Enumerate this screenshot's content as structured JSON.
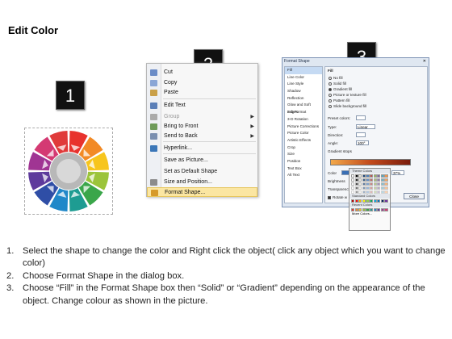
{
  "title": "Edit Color",
  "badges": [
    "1",
    "2",
    "3"
  ],
  "wheel": {
    "segment_colors": [
      "#e8322d",
      "#f28a25",
      "#f7c51d",
      "#9bc43a",
      "#3aa64a",
      "#1e9c92",
      "#1f88c9",
      "#2f4ea6",
      "#5e3a9c",
      "#a03593",
      "#d43a73",
      "#e03a3a"
    ],
    "center_color": "#b8b8b8"
  },
  "context_menu": {
    "items": [
      {
        "label": "Cut",
        "icon": "cut-icon",
        "enabled": true,
        "submenu": false
      },
      {
        "label": "Copy",
        "icon": "copy-icon",
        "enabled": true,
        "submenu": false
      },
      {
        "label": "Paste",
        "icon": "paste-icon",
        "enabled": true,
        "submenu": false
      },
      {
        "label": "Edit Text",
        "icon": "edit-text-icon",
        "enabled": true,
        "submenu": false
      },
      {
        "label": "Group",
        "icon": "group-icon",
        "enabled": false,
        "submenu": true
      },
      {
        "label": "Bring to Front",
        "icon": "bring-to-front-icon",
        "enabled": true,
        "submenu": true
      },
      {
        "label": "Send to Back",
        "icon": "send-to-back-icon",
        "enabled": true,
        "submenu": true
      },
      {
        "label": "Hyperlink...",
        "icon": "hyperlink-icon",
        "enabled": true,
        "submenu": false
      },
      {
        "label": "Save as Picture...",
        "icon": "",
        "enabled": true,
        "submenu": false
      },
      {
        "label": "Set as Default Shape",
        "icon": "",
        "enabled": true,
        "submenu": false
      },
      {
        "label": "Size and Position...",
        "icon": "size-position-icon",
        "enabled": true,
        "submenu": false
      },
      {
        "label": "Format Shape...",
        "icon": "format-shape-icon",
        "enabled": true,
        "submenu": false,
        "highlighted": true
      }
    ]
  },
  "format_dialog": {
    "title": "Format Shape",
    "categories": [
      "Fill",
      "Line Color",
      "Line Style",
      "Shadow",
      "Reflection",
      "Glow and Soft Edges",
      "3-D Format",
      "3-D Rotation",
      "Picture Corrections",
      "Picture Color",
      "Artistic Effects",
      "Crop",
      "Size",
      "Position",
      "Text Box",
      "Alt Text"
    ],
    "section_title": "Fill",
    "fill_options": [
      {
        "label": "No fill",
        "checked": false
      },
      {
        "label": "Solid fill",
        "checked": false
      },
      {
        "label": "Gradient fill",
        "checked": true
      },
      {
        "label": "Picture or texture fill",
        "checked": false
      },
      {
        "label": "Pattern fill",
        "checked": false
      },
      {
        "label": "Slide background fill",
        "checked": false
      }
    ],
    "preset_colors_label": "Preset colors:",
    "type_label": "Type:",
    "type_value": "Linear",
    "direction_label": "Direction:",
    "angle_label": "Angle:",
    "angle_value": "100°",
    "gradient_stops_label": "Gradient stops",
    "color_label": "Color",
    "position_label": "Position:",
    "position_value": "37%",
    "brightness_label": "Brightness",
    "transparency_label": "Transparency",
    "rotate_label": "Rotate w",
    "close_label": "Close"
  },
  "palette": {
    "theme_header": "Theme Colors",
    "standard_header": "Standard Colors",
    "recent_header": "Recent Colors",
    "more_colors": "More Colors...",
    "theme_colors": [
      "#ffffff",
      "#000000",
      "#eeece1",
      "#1f497d",
      "#4f81bd",
      "#c0504d",
      "#9bbb59",
      "#8064a2",
      "#4bacc6",
      "#f79646"
    ],
    "standard_colors": [
      "#c00000",
      "#ff0000",
      "#ffc000",
      "#ffff00",
      "#92d050",
      "#00b050",
      "#00b0f0",
      "#0070c0",
      "#002060",
      "#7030a0"
    ],
    "recent_colors": [
      "#e8322d",
      "#f28a25",
      "#f7c51d",
      "#9bc43a",
      "#3aa64a",
      "#1e9c92",
      "#1f88c9",
      "#5e3a9c",
      "#a03593",
      "#d43a73"
    ]
  },
  "instructions": [
    {
      "num": "1.",
      "text": "Select the shape to change the color and Right click the object( click any object which you want to change color)"
    },
    {
      "num": "2.",
      "text": "Choose Format Shape in the dialog box."
    },
    {
      "num": "3.",
      "text": "Choose “Fill” in the Format Shape box then “Solid” or “Gradient” depending on the appearance of the object. Change colour as shown in the picture."
    }
  ]
}
